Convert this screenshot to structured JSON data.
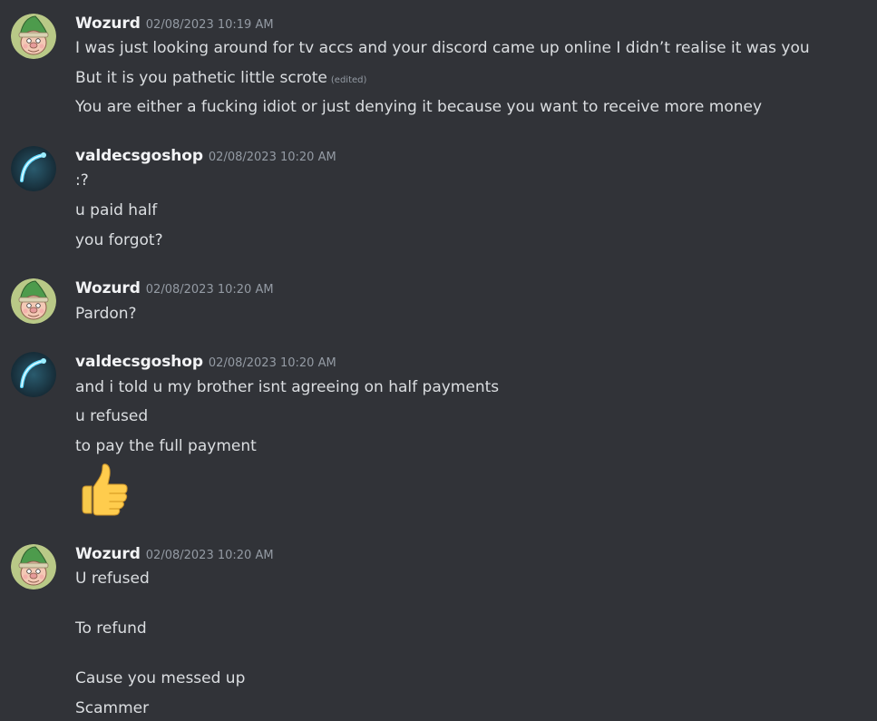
{
  "messages": [
    {
      "author": "Wozurd",
      "timestamp": "02/08/2023 10:19 AM",
      "lines": [
        "I was just looking around for tv accs and your discord came up online I didn’t realise it was you",
        "But it is you pathetic little scrote",
        "You are either a fucking idiot or just denying it because you want to receive more money"
      ],
      "edited_label": "(edited)"
    },
    {
      "author": "valdecsgoshop",
      "timestamp": "02/08/2023 10:20 AM",
      "lines": [
        ":?",
        "u paid half",
        "you forgot?"
      ]
    },
    {
      "author": "Wozurd",
      "timestamp": "02/08/2023 10:20 AM",
      "lines": [
        "Pardon?"
      ]
    },
    {
      "author": "valdecsgoshop",
      "timestamp": "02/08/2023 10:20 AM",
      "lines": [
        "and i told u my brother isnt agreeing on half payments",
        "u refused",
        "to pay the full payment"
      ],
      "emoji": "thumbs-up"
    },
    {
      "author": "Wozurd",
      "timestamp": "02/08/2023 10:20 AM",
      "lines": [
        "U refused",
        "To refund",
        "Cause you messed up",
        "Scammer"
      ]
    }
  ],
  "colors": {
    "background": "#313338",
    "username": "#f2f3f5",
    "text": "#dbdee1",
    "muted": "#949ba4"
  }
}
